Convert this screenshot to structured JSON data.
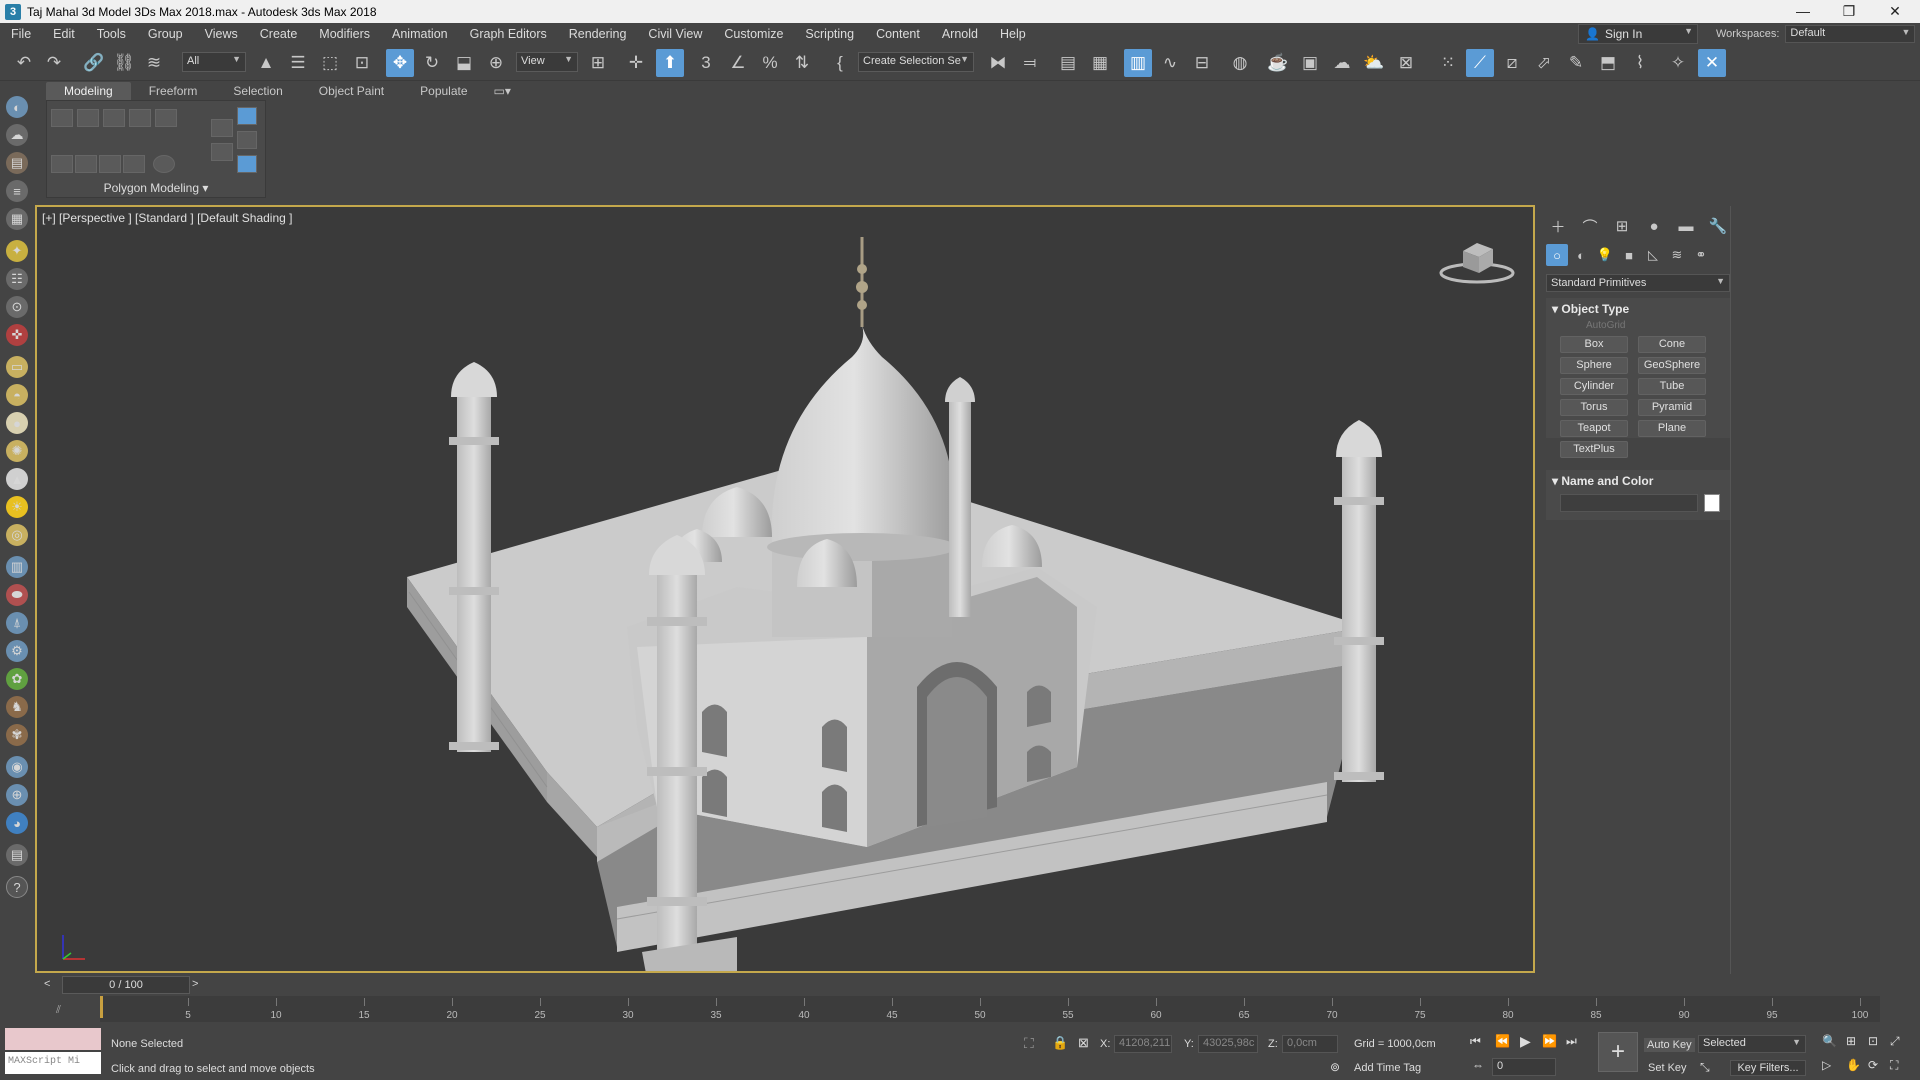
{
  "window": {
    "title": "Taj Mahal 3d Model 3Ds Max 2018.max - Autodesk 3ds Max 2018",
    "controls": [
      "—",
      "❐",
      "✕"
    ]
  },
  "menu": [
    "File",
    "Edit",
    "Tools",
    "Group",
    "Views",
    "Create",
    "Modifiers",
    "Animation",
    "Graph Editors",
    "Rendering",
    "Civil View",
    "Customize",
    "Scripting",
    "Content",
    "Arnold",
    "Help"
  ],
  "account": {
    "signin": "Sign In",
    "workspaces_label": "Workspaces:",
    "workspace": "Default"
  },
  "toolbar": {
    "filter": "All",
    "ref_coord": "View",
    "selection_set": "Create Selection Se"
  },
  "ribbon": {
    "tabs": [
      "Modeling",
      "Freeform",
      "Selection",
      "Object Paint",
      "Populate"
    ],
    "active_tab": 0,
    "panel_label": "Polygon Modeling ▾"
  },
  "viewport": {
    "label": "[+] [Perspective ] [Standard ] [Default Shading ]"
  },
  "command_panel": {
    "category": "Standard Primitives",
    "object_type_title": "Object Type",
    "autogrid": "AutoGrid",
    "primitives": [
      "Box",
      "Cone",
      "Sphere",
      "GeoSphere",
      "Cylinder",
      "Tube",
      "Torus",
      "Pyramid",
      "Teapot",
      "Plane",
      "TextPlus"
    ],
    "name_color_title": "Name and Color"
  },
  "time": {
    "frame": "0 / 100",
    "ticks": [
      "5",
      "10",
      "15",
      "20",
      "25",
      "30",
      "35",
      "40",
      "45",
      "50",
      "55",
      "60",
      "65",
      "70",
      "75",
      "80",
      "85",
      "90",
      "95",
      "100"
    ]
  },
  "status": {
    "maxscript": "MAXScript Mi",
    "selection": "None Selected",
    "prompt": "Click and drag to select and move objects",
    "x_label": "X:",
    "x_value": "41208,211",
    "y_label": "Y:",
    "y_value": "43025,98c",
    "z_label": "Z:",
    "z_value": "0,0cm",
    "grid": "Grid = 1000,0cm",
    "add_time_tag": "Add Time Tag",
    "auto_key": "Auto Key",
    "set_key": "Set Key",
    "key_mode": "Selected",
    "key_filters": "Key Filters...",
    "current_frame": "0"
  }
}
